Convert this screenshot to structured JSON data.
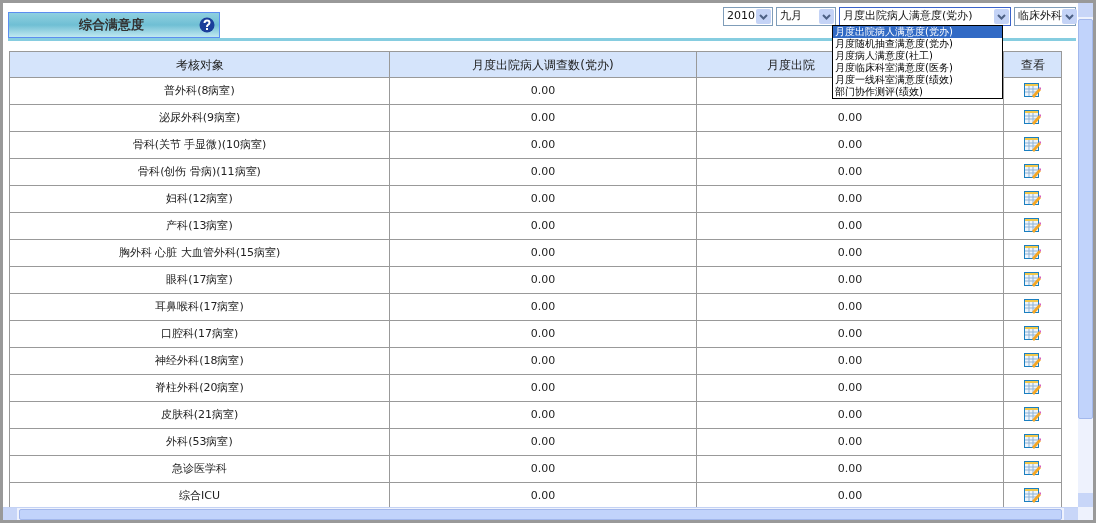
{
  "panel_tab": {
    "title": "综合满意度"
  },
  "filters": [
    {
      "kind": "year",
      "value": "2010"
    },
    {
      "kind": "month",
      "value": "九月"
    },
    {
      "kind": "survey",
      "value": "月度出院病人满意度(党办)",
      "open": true
    },
    {
      "kind": "department",
      "value": "临床外科"
    }
  ],
  "survey_options": [
    {
      "label": "月度出院病人满意度(党办)",
      "selected": true
    },
    {
      "label": "月度随机抽查满意度(党办)",
      "selected": false
    },
    {
      "label": "月度病人满意度(社工)",
      "selected": false
    },
    {
      "label": "月度临床科室满意度(医务)",
      "selected": false
    },
    {
      "label": "月度一线科室满意度(绩效)",
      "selected": false
    },
    {
      "label": "部门协作测评(绩效)",
      "selected": false
    }
  ],
  "table": {
    "columns": [
      "考核对象",
      "月度出院病人调查数(党办)",
      "月度出院",
      "查看"
    ],
    "rows": [
      {
        "target": "普外科(8病室)",
        "column_2": "0.00"
      },
      {
        "target": "泌尿外科(9病室)",
        "column_2": "0.00",
        "column_3": "0.00"
      },
      {
        "target": "骨科(关节 手显微)(10病室)",
        "column_2": "0.00",
        "column_3": "0.00"
      },
      {
        "target": "骨科(创伤 骨病)(11病室)",
        "column_2": "0.00",
        "column_3": "0.00"
      },
      {
        "target": "妇科(12病室)",
        "column_2": "0.00",
        "column_3": "0.00"
      },
      {
        "target": "产科(13病室)",
        "column_2": "0.00",
        "column_3": "0.00"
      },
      {
        "target": "胸外科 心脏 大血管外科(15病室)",
        "column_2": "0.00",
        "column_3": "0.00"
      },
      {
        "target": "眼科(17病室)",
        "column_2": "0.00",
        "column_3": "0.00"
      },
      {
        "target": "耳鼻喉科(17病室)",
        "column_2": "0.00",
        "column_3": "0.00"
      },
      {
        "target": "口腔科(17病室)",
        "column_2": "0.00",
        "column_3": "0.00"
      },
      {
        "target": "神经外科(18病室)",
        "column_2": "0.00",
        "column_3": "0.00"
      },
      {
        "target": "脊柱外科(20病室)",
        "column_2": "0.00",
        "column_3": "0.00"
      },
      {
        "target": "皮肤科(21病室)",
        "column_2": "0.00",
        "column_3": "0.00"
      },
      {
        "target": "外科(53病室)",
        "column_2": "0.00",
        "column_3": "0.00"
      },
      {
        "target": "急诊医学科",
        "column_2": "0.00",
        "column_3": "0.00"
      },
      {
        "target": "综合ICU",
        "column_2": "0.00",
        "column_3": "0.00"
      }
    ]
  }
}
